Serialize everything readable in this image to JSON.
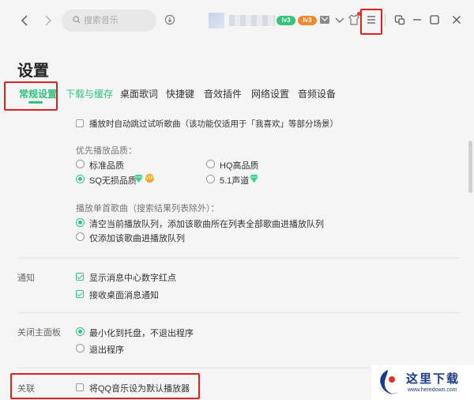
{
  "topbar": {
    "search_placeholder": "搜索音乐",
    "badge_svip": "lv3",
    "badge_vip": "lv3"
  },
  "page": {
    "title": "设置"
  },
  "tabs": [
    {
      "label": "常规设置",
      "active": true
    },
    {
      "label": "下载与缓存",
      "active": false
    },
    {
      "label": "桌面歌词",
      "active": false
    },
    {
      "label": "快捷键",
      "active": false
    },
    {
      "label": "音效插件",
      "active": false
    },
    {
      "label": "网络设置",
      "active": false
    },
    {
      "label": "音频设备",
      "active": false
    }
  ],
  "general": {
    "skip_trial": {
      "label": "播放时自动跳过试听歌曲（该功能仅适用于「我喜欢」等部分场景）",
      "checked": false
    },
    "quality": {
      "heading": "优先播放品质：",
      "options": [
        {
          "label": "标准品质",
          "checked": false
        },
        {
          "label": "HQ高品质",
          "checked": false
        },
        {
          "label": "SQ无损品质",
          "checked": true
        },
        {
          "label": "5.1声道",
          "checked": false
        }
      ],
      "vip_coin": "VIP"
    },
    "single_song": {
      "heading": "播放单首歌曲（搜索结果列表除外）：",
      "options": [
        {
          "label": "清空当前播放队列，添加该歌曲所在列表全部歌曲进播放队列",
          "checked": true
        },
        {
          "label": "仅添加该歌曲进播放队列",
          "checked": false
        }
      ]
    }
  },
  "notify": {
    "label": "通知",
    "options": [
      {
        "label": "显示消息中心数字红点",
        "checked": true
      },
      {
        "label": "接收桌面消息通知",
        "checked": true
      }
    ]
  },
  "close_panel": {
    "label": "关闭主面板",
    "options": [
      {
        "label": "最小化到托盘，不退出程序",
        "checked": true
      },
      {
        "label": "退出程序",
        "checked": false
      }
    ]
  },
  "association": {
    "label": "关联",
    "option": {
      "label": "将QQ音乐设为默认播放器",
      "checked": false
    }
  },
  "watermark": {
    "cn": "这里下载",
    "url": "www.heredown.com"
  },
  "colors": {
    "accent": "#31c27c",
    "highlight": "#e02020"
  }
}
